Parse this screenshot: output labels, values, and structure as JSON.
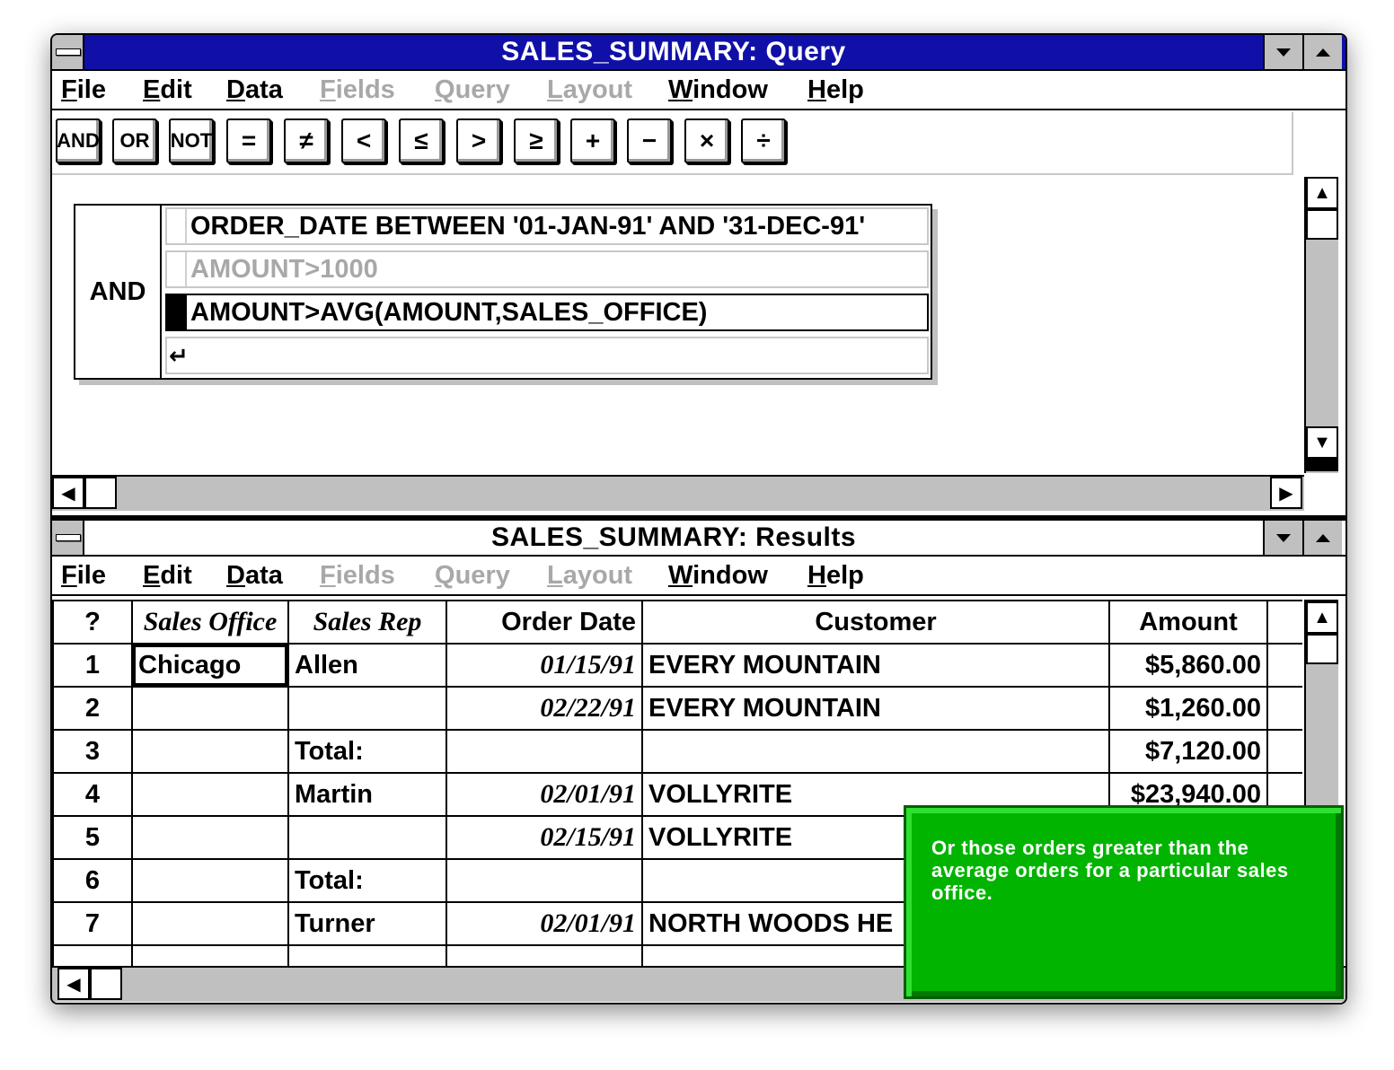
{
  "query_window": {
    "title": "SALES_SUMMARY: Query",
    "menu": [
      {
        "label": "File",
        "disabled": false
      },
      {
        "label": "Edit",
        "disabled": false
      },
      {
        "label": "Data",
        "disabled": false
      },
      {
        "label": "Fields",
        "disabled": true
      },
      {
        "label": "Query",
        "disabled": true
      },
      {
        "label": "Layout",
        "disabled": true
      },
      {
        "label": "Window",
        "disabled": false
      },
      {
        "label": "Help",
        "disabled": false
      }
    ],
    "toolbar": [
      "AND",
      "OR",
      "NOT",
      "=",
      "≠",
      "<",
      "≤",
      ">",
      "≥",
      "+",
      "−",
      "×",
      "÷"
    ],
    "criteria": {
      "operator": "AND",
      "rows": [
        {
          "text": "ORDER_DATE BETWEEN '01-JAN-91' AND '31-DEC-91'",
          "state": "normal"
        },
        {
          "text": "AMOUNT>1000",
          "state": "dimmed"
        },
        {
          "text": "AMOUNT>AVG(AMOUNT,SALES_OFFICE)",
          "state": "active"
        },
        {
          "text": "",
          "state": "new"
        }
      ]
    }
  },
  "results_window": {
    "title": "SALES_SUMMARY: Results",
    "menu": [
      {
        "label": "File",
        "disabled": false
      },
      {
        "label": "Edit",
        "disabled": false
      },
      {
        "label": "Data",
        "disabled": false
      },
      {
        "label": "Fields",
        "disabled": true
      },
      {
        "label": "Query",
        "disabled": true
      },
      {
        "label": "Layout",
        "disabled": true
      },
      {
        "label": "Window",
        "disabled": false
      },
      {
        "label": "Help",
        "disabled": false
      }
    ],
    "columns": [
      "?",
      "Sales Office",
      "Sales Rep",
      "Order Date",
      "Customer",
      "Amount"
    ],
    "rows": [
      [
        "1",
        "Chicago",
        "Allen",
        "01/15/91",
        "EVERY MOUNTAIN",
        "$5,860.00"
      ],
      [
        "2",
        "",
        "",
        "02/22/91",
        "EVERY MOUNTAIN",
        "$1,260.00"
      ],
      [
        "3",
        "",
        "Total:",
        "",
        "",
        "$7,120.00"
      ],
      [
        "4",
        "",
        "Martin",
        "02/01/91",
        "VOLLYRITE",
        "$23,940.00"
      ],
      [
        "5",
        "",
        "",
        "02/15/91",
        "VOLLYRITE",
        ""
      ],
      [
        "6",
        "",
        "Total:",
        "",
        "",
        ""
      ],
      [
        "7",
        "",
        "Turner",
        "02/01/91",
        "NORTH WOODS HE",
        ""
      ],
      [
        "",
        "",
        "",
        "",
        "",
        ""
      ]
    ]
  },
  "tooltip": {
    "text": "Or those orders greater than the average orders for a particular sales office."
  },
  "colors": {
    "active_titlebar": "#1010a8",
    "tooltip_bg": "#00b400",
    "disabled_menu": "#a8a8a8"
  }
}
